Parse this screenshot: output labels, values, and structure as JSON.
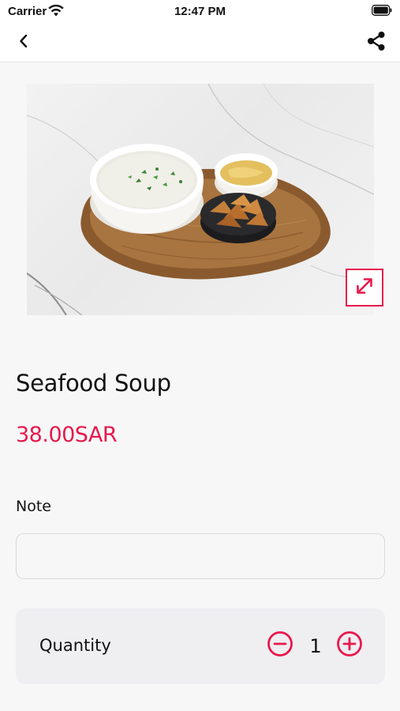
{
  "status_bar": {
    "carrier": "Carrier",
    "time": "12:47 PM",
    "wifi_icon": "wifi-icon",
    "battery_icon": "battery-icon"
  },
  "nav": {
    "back_icon": "chevron-left-icon",
    "share_icon": "share-icon"
  },
  "product": {
    "name": "Seafood Soup",
    "price": "38.00SAR",
    "expand_icon": "expand-icon"
  },
  "note": {
    "label": "Note",
    "value": "",
    "placeholder": ""
  },
  "quantity": {
    "label": "Quantity",
    "value": "1",
    "minus_icon": "minus-circle-icon",
    "plus_icon": "plus-circle-icon"
  },
  "colors": {
    "accent": "#e8194b",
    "background": "#f7f7f8",
    "card": "#efeef1"
  }
}
